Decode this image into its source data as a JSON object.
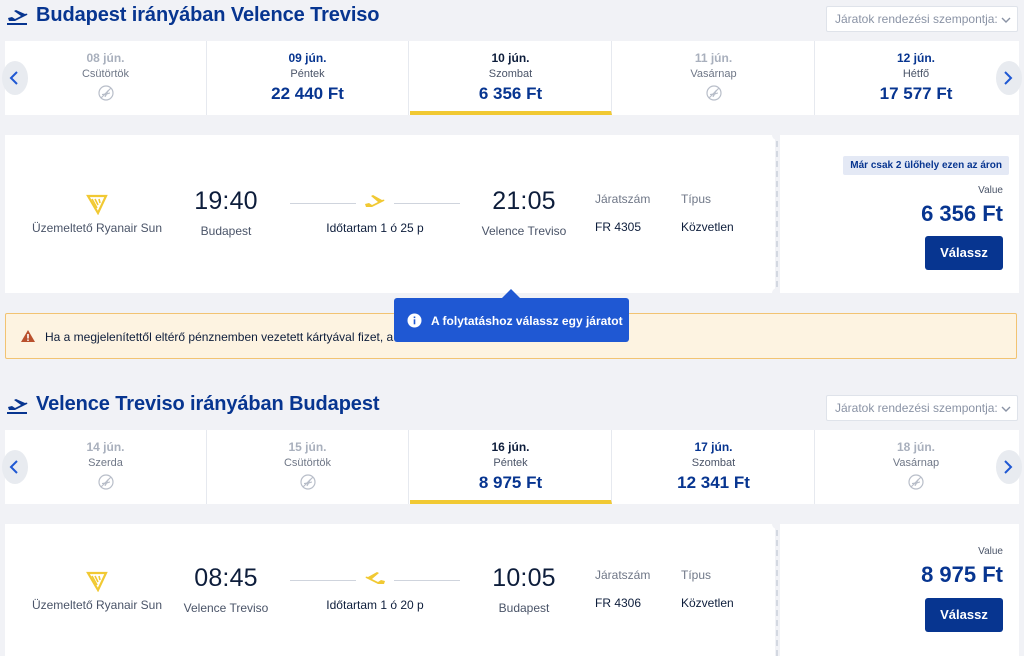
{
  "outbound": {
    "title": "Budapest irányában Velence Treviso",
    "sort_placeholder": "Járatok rendezési szempontja:",
    "dates": [
      {
        "date": "08 jún.",
        "weekday": "Csütörtök",
        "price": "",
        "status": "disabled"
      },
      {
        "date": "09 jún.",
        "weekday": "Péntek",
        "price": "22 440 Ft",
        "status": "enabled"
      },
      {
        "date": "10 jún.",
        "weekday": "Szombat",
        "price": "6 356 Ft",
        "status": "selected"
      },
      {
        "date": "11 jún.",
        "weekday": "Vasárnap",
        "price": "",
        "status": "disabled"
      },
      {
        "date": "12 jún.",
        "weekday": "Hétfő",
        "price": "17 577 Ft",
        "status": "enabled"
      }
    ],
    "flight": {
      "operator": "Üzemeltető Ryanair Sun",
      "dep_time": "19:40",
      "dep_city": "Budapest",
      "duration": "Időtartam 1 ó 25 p",
      "arr_time": "21:05",
      "arr_city": "Velence Treviso",
      "flight_no_label": "Járatszám",
      "flight_no": "FR 4305",
      "type_label": "Típus",
      "type": "Közvetlen",
      "seats_badge": "Már csak 2 ülőhely ezen az áron",
      "value_label": "Value",
      "price": "6 356 Ft",
      "select_label": "Válassz"
    }
  },
  "warning": {
    "text": "Ha a megjelenítettől eltérő pénznemben vezetett kártyával fizet, a"
  },
  "tooltip": {
    "text": "A folytatáshoz válassz egy járatot"
  },
  "inbound": {
    "title": "Velence Treviso irányában Budapest",
    "sort_placeholder": "Járatok rendezési szempontja:",
    "dates": [
      {
        "date": "14 jún.",
        "weekday": "Szerda",
        "price": "",
        "status": "disabled"
      },
      {
        "date": "15 jún.",
        "weekday": "Csütörtök",
        "price": "",
        "status": "disabled"
      },
      {
        "date": "16 jún.",
        "weekday": "Péntek",
        "price": "8 975 Ft",
        "status": "selected"
      },
      {
        "date": "17 jún.",
        "weekday": "Szombat",
        "price": "12 341 Ft",
        "status": "enabled"
      },
      {
        "date": "18 jún.",
        "weekday": "Vasárnap",
        "price": "",
        "status": "disabled"
      }
    ],
    "flight": {
      "operator": "Üzemeltető Ryanair Sun",
      "dep_time": "08:45",
      "dep_city": "Velence Treviso",
      "duration": "Időtartam 1 ó 20 p",
      "arr_time": "10:05",
      "arr_city": "Budapest",
      "flight_no_label": "Járatszám",
      "flight_no": "FR 4306",
      "type_label": "Típus",
      "type": "Közvetlen",
      "value_label": "Value",
      "price": "8 975 Ft",
      "select_label": "Válassz"
    }
  },
  "colors": {
    "brand_blue": "#073590",
    "accent_yellow": "#f1c933",
    "tooltip_blue": "#1f58d3",
    "warning_bg": "#fdf3e1"
  },
  "icons": {
    "departure": "plane-departure-icon",
    "no_flight": "no-flight-icon",
    "harp_logo": "ryanair-harp-icon",
    "warning": "warning-icon",
    "info": "info-icon"
  }
}
